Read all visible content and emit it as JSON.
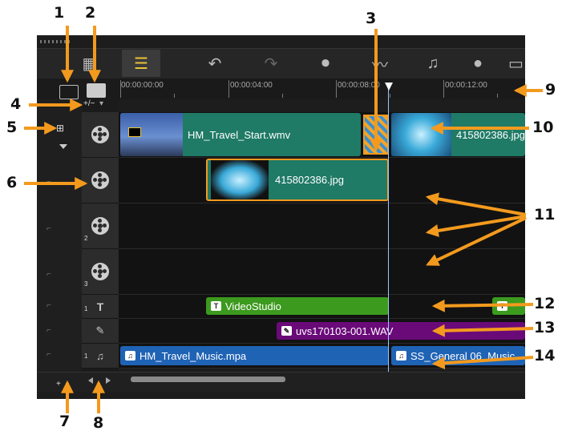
{
  "callouts": [
    "1",
    "2",
    "3",
    "4",
    "5",
    "6",
    "7",
    "8",
    "9",
    "10",
    "11",
    "12",
    "13",
    "14"
  ],
  "toolbar": {
    "icons": [
      "film-strip-icon",
      "storyboard-icon",
      "undo-icon",
      "redo-icon",
      "record-capture-icon",
      "sound-mixer-icon",
      "auto-music-icon",
      "motion-tracking-icon",
      "subtitle-icon"
    ]
  },
  "ruler": {
    "labels": [
      "00:00:00:00",
      "00:00:04:00",
      "00:00:08:00",
      "00:00:12:00"
    ]
  },
  "controls": {
    "add_remove": "+/−",
    "ripple_dropdown": "▾",
    "add_track": "+"
  },
  "track_numbers": [
    "2",
    "3",
    "1",
    "1"
  ],
  "clips": {
    "video_start": "HM_Travel_Start.wmv",
    "video_jpg": "415802386.jpg",
    "overlay_jpg": "415802386.jpg",
    "title": "VideoStudio",
    "voice": "uvs170103-001.WAV",
    "music1": "HM_Travel_Music.mpa",
    "music2": "SS_General 06_Music"
  },
  "colors": {
    "accent": "#f39a1e",
    "video_clip": "#1f7a66",
    "title_clip": "#3c9a1e",
    "voice_clip": "#6a0a79",
    "music_clip": "#1f63b5",
    "playhead": "#9ac8ff"
  }
}
